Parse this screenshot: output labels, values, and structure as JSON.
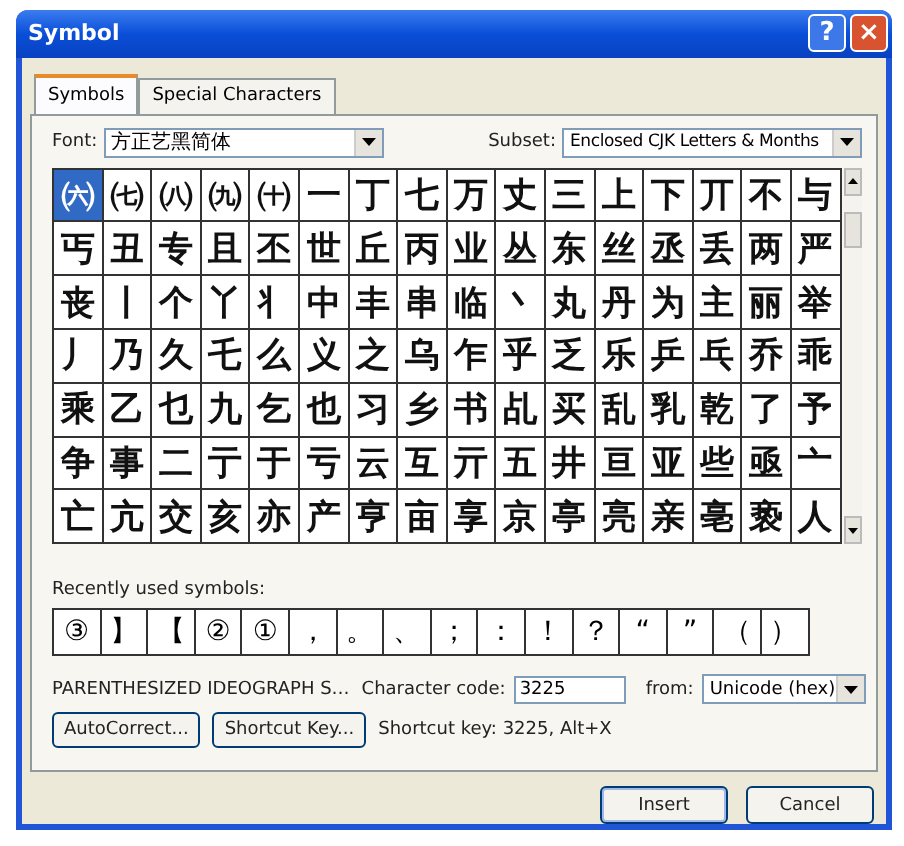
{
  "window": {
    "title": "Symbol",
    "help_button": "?",
    "close_button": "×"
  },
  "tabs": [
    {
      "label": "Symbols",
      "selected": true
    },
    {
      "label": "Special Characters",
      "selected": false
    }
  ],
  "font": {
    "label": "Font:",
    "value": "方正艺黑简体"
  },
  "subset": {
    "label": "Subset:",
    "value": "Enclosed CJK Letters & Months"
  },
  "grid": [
    [
      {
        "char": "㈥",
        "selected": true
      },
      {
        "char": "㈦",
        "selected": false
      },
      {
        "char": "㈧",
        "selected": false
      },
      {
        "char": "㈨",
        "selected": false
      },
      {
        "char": "㈩",
        "selected": false
      },
      {
        "char": "一",
        "selected": false
      },
      {
        "char": "丁",
        "selected": false
      },
      {
        "char": "七",
        "selected": false
      },
      {
        "char": "万",
        "selected": false
      },
      {
        "char": "丈",
        "selected": false
      },
      {
        "char": "三",
        "selected": false
      },
      {
        "char": "上",
        "selected": false
      },
      {
        "char": "下",
        "selected": false
      },
      {
        "char": "丌",
        "selected": false
      },
      {
        "char": "不",
        "selected": false
      },
      {
        "char": "与",
        "selected": false
      }
    ],
    [
      {
        "char": "丐",
        "selected": false
      },
      {
        "char": "丑",
        "selected": false
      },
      {
        "char": "专",
        "selected": false
      },
      {
        "char": "且",
        "selected": false
      },
      {
        "char": "丕",
        "selected": false
      },
      {
        "char": "世",
        "selected": false
      },
      {
        "char": "丘",
        "selected": false
      },
      {
        "char": "丙",
        "selected": false
      },
      {
        "char": "业",
        "selected": false
      },
      {
        "char": "丛",
        "selected": false
      },
      {
        "char": "东",
        "selected": false
      },
      {
        "char": "丝",
        "selected": false
      },
      {
        "char": "丞",
        "selected": false
      },
      {
        "char": "丢",
        "selected": false
      },
      {
        "char": "两",
        "selected": false
      },
      {
        "char": "严",
        "selected": false
      }
    ],
    [
      {
        "char": "丧",
        "selected": false
      },
      {
        "char": "丨",
        "selected": false
      },
      {
        "char": "个",
        "selected": false
      },
      {
        "char": "丫",
        "selected": false
      },
      {
        "char": "丬",
        "selected": false
      },
      {
        "char": "中",
        "selected": false
      },
      {
        "char": "丰",
        "selected": false
      },
      {
        "char": "串",
        "selected": false
      },
      {
        "char": "临",
        "selected": false
      },
      {
        "char": "丶",
        "selected": false
      },
      {
        "char": "丸",
        "selected": false
      },
      {
        "char": "丹",
        "selected": false
      },
      {
        "char": "为",
        "selected": false
      },
      {
        "char": "主",
        "selected": false
      },
      {
        "char": "丽",
        "selected": false
      },
      {
        "char": "举",
        "selected": false
      }
    ],
    [
      {
        "char": "丿",
        "selected": false
      },
      {
        "char": "乃",
        "selected": false
      },
      {
        "char": "久",
        "selected": false
      },
      {
        "char": "乇",
        "selected": false
      },
      {
        "char": "么",
        "selected": false
      },
      {
        "char": "义",
        "selected": false
      },
      {
        "char": "之",
        "selected": false
      },
      {
        "char": "乌",
        "selected": false
      },
      {
        "char": "乍",
        "selected": false
      },
      {
        "char": "乎",
        "selected": false
      },
      {
        "char": "乏",
        "selected": false
      },
      {
        "char": "乐",
        "selected": false
      },
      {
        "char": "乒",
        "selected": false
      },
      {
        "char": "乓",
        "selected": false
      },
      {
        "char": "乔",
        "selected": false
      },
      {
        "char": "乖",
        "selected": false
      }
    ],
    [
      {
        "char": "乘",
        "selected": false
      },
      {
        "char": "乙",
        "selected": false
      },
      {
        "char": "乜",
        "selected": false
      },
      {
        "char": "九",
        "selected": false
      },
      {
        "char": "乞",
        "selected": false
      },
      {
        "char": "也",
        "selected": false
      },
      {
        "char": "习",
        "selected": false
      },
      {
        "char": "乡",
        "selected": false
      },
      {
        "char": "书",
        "selected": false
      },
      {
        "char": "乩",
        "selected": false
      },
      {
        "char": "买",
        "selected": false
      },
      {
        "char": "乱",
        "selected": false
      },
      {
        "char": "乳",
        "selected": false
      },
      {
        "char": "乾",
        "selected": false
      },
      {
        "char": "了",
        "selected": false
      },
      {
        "char": "予",
        "selected": false
      }
    ],
    [
      {
        "char": "争",
        "selected": false
      },
      {
        "char": "事",
        "selected": false
      },
      {
        "char": "二",
        "selected": false
      },
      {
        "char": "亍",
        "selected": false
      },
      {
        "char": "于",
        "selected": false
      },
      {
        "char": "亏",
        "selected": false
      },
      {
        "char": "云",
        "selected": false
      },
      {
        "char": "互",
        "selected": false
      },
      {
        "char": "亓",
        "selected": false
      },
      {
        "char": "五",
        "selected": false
      },
      {
        "char": "井",
        "selected": false
      },
      {
        "char": "亘",
        "selected": false
      },
      {
        "char": "亚",
        "selected": false
      },
      {
        "char": "些",
        "selected": false
      },
      {
        "char": "亟",
        "selected": false
      },
      {
        "char": "亠",
        "selected": false
      }
    ],
    [
      {
        "char": "亡",
        "selected": false
      },
      {
        "char": "亢",
        "selected": false
      },
      {
        "char": "交",
        "selected": false
      },
      {
        "char": "亥",
        "selected": false
      },
      {
        "char": "亦",
        "selected": false
      },
      {
        "char": "产",
        "selected": false
      },
      {
        "char": "亨",
        "selected": false
      },
      {
        "char": "亩",
        "selected": false
      },
      {
        "char": "享",
        "selected": false
      },
      {
        "char": "京",
        "selected": false
      },
      {
        "char": "亭",
        "selected": false
      },
      {
        "char": "亮",
        "selected": false
      },
      {
        "char": "亲",
        "selected": false
      },
      {
        "char": "亳",
        "selected": false
      },
      {
        "char": "亵",
        "selected": false
      },
      {
        "char": "人",
        "selected": false
      }
    ]
  ],
  "recent": {
    "label": "Recently used symbols:",
    "symbols": [
      "③",
      "】",
      "【",
      "②",
      "①",
      "，",
      "。",
      "、",
      "；",
      "：",
      "！",
      "？",
      "“",
      "”",
      "（",
      "）"
    ]
  },
  "character_name": "PARENTHESIZED IDEOGRAPH S…",
  "character_code": {
    "label": "Character code:",
    "value": "3225"
  },
  "from": {
    "label": "from:",
    "value": "Unicode (hex)"
  },
  "autocorrect_button": "AutoCorrect...",
  "shortcut_key_button": "Shortcut Key...",
  "shortcut_info": "Shortcut key: 3225, Alt+X",
  "buttons": [
    "Insert",
    "Cancel"
  ]
}
